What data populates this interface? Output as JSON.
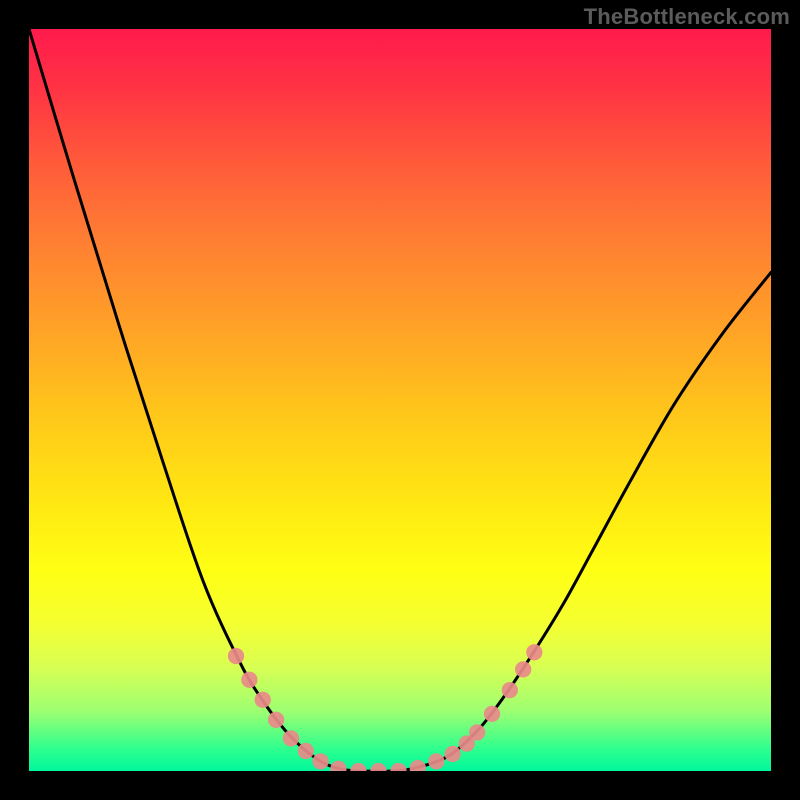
{
  "watermark": "TheBottleneck.com",
  "chart_data": {
    "type": "line",
    "title": "",
    "xlabel": "",
    "ylabel": "",
    "xlim": [
      0,
      1
    ],
    "ylim": [
      0,
      1
    ],
    "background": "rainbow-gradient",
    "series": [
      {
        "name": "bottleneck-curve",
        "color": "#000000",
        "x": [
          0.0,
          0.06,
          0.12,
          0.18,
          0.235,
          0.285,
          0.315,
          0.345,
          0.37,
          0.395,
          0.415,
          0.44,
          0.465,
          0.49,
          0.52,
          0.565,
          0.605,
          0.64,
          0.68,
          0.72,
          0.76,
          0.81,
          0.87,
          0.935,
          1.0
        ],
        "y": [
          1.0,
          0.8,
          0.605,
          0.418,
          0.255,
          0.145,
          0.095,
          0.055,
          0.03,
          0.012,
          0.004,
          0.0,
          0.0,
          0.0,
          0.004,
          0.02,
          0.055,
          0.1,
          0.16,
          0.225,
          0.298,
          0.39,
          0.495,
          0.59,
          0.672
        ]
      }
    ],
    "tick_markers": {
      "name": "pink-dots",
      "color": "#e98a8a",
      "radius_norm": 0.011,
      "points_norm": [
        [
          0.279,
          0.155
        ],
        [
          0.297,
          0.123
        ],
        [
          0.315,
          0.096
        ],
        [
          0.333,
          0.069
        ],
        [
          0.353,
          0.044
        ],
        [
          0.373,
          0.027
        ],
        [
          0.393,
          0.013
        ],
        [
          0.417,
          0.003
        ],
        [
          0.444,
          0.0
        ],
        [
          0.471,
          0.0
        ],
        [
          0.498,
          0.0
        ],
        [
          0.524,
          0.004
        ],
        [
          0.549,
          0.013
        ],
        [
          0.571,
          0.023
        ],
        [
          0.59,
          0.037
        ],
        [
          0.604,
          0.052
        ],
        [
          0.624,
          0.077
        ],
        [
          0.648,
          0.109
        ],
        [
          0.666,
          0.137
        ],
        [
          0.681,
          0.16
        ]
      ]
    }
  }
}
